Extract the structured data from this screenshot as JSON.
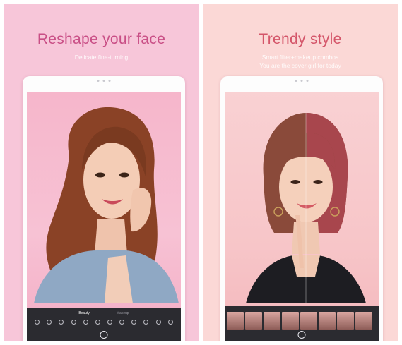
{
  "panels": {
    "left": {
      "title": "Reshape your face",
      "subtitle": "Delicate fine-turning",
      "tabs": [
        "Beauty",
        "Makeup"
      ],
      "tools": [
        "",
        "",
        "",
        "",
        "",
        "",
        "",
        "",
        "",
        "",
        "",
        ""
      ]
    },
    "right": {
      "title": "Trendy style",
      "subtitle_line1": "Smart filter+makeup combos",
      "subtitle_line2": "You are the cover girl for today",
      "filter_tabs": [
        "",
        "",
        "",
        "",
        "",
        ""
      ],
      "thumb_count": 8
    }
  },
  "colors": {
    "left_bg": "#f7c6d9",
    "right_bg": "#fbd8d6",
    "left_title": "#c94f86",
    "right_title": "#d4566a",
    "toolbar": "#2b2b30"
  },
  "icons": [
    "camera-shutter-icon",
    "reshape-tool-icon",
    "filter-thumbnail-icon"
  ]
}
